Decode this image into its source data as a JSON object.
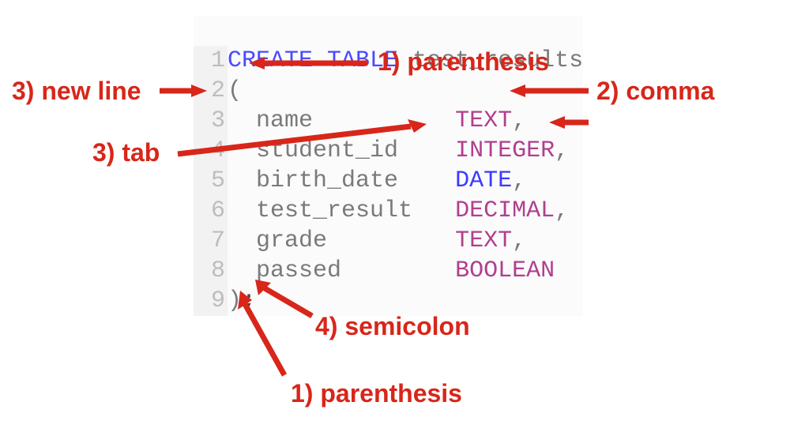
{
  "code": {
    "lines": [
      {
        "n": "1",
        "text": "CREATE TABLE test_results"
      },
      {
        "n": "2",
        "text": "("
      },
      {
        "n": "3",
        "text": "  name          TEXT,"
      },
      {
        "n": "4",
        "text": "  student_id    INTEGER,"
      },
      {
        "n": "5",
        "text": "  birth_date    DATE,"
      },
      {
        "n": "6",
        "text": "  test_result   DECIMAL,"
      },
      {
        "n": "7",
        "text": "  grade         TEXT,"
      },
      {
        "n": "8",
        "text": "  passed        BOOLEAN"
      },
      {
        "n": "9",
        "text": ");"
      }
    ],
    "tokens": {
      "create": "CREATE",
      "table": "TABLE",
      "tname": "test_results",
      "open": "(",
      "close": ")",
      "semi": ";",
      "cols": [
        {
          "name": "name",
          "type": "TEXT",
          "comma": ","
        },
        {
          "name": "student_id",
          "type": "INTEGER",
          "comma": ","
        },
        {
          "name": "birth_date",
          "type": "DATE",
          "comma": ","
        },
        {
          "name": "test_result",
          "type": "DECIMAL",
          "comma": ","
        },
        {
          "name": "grade",
          "type": "TEXT",
          "comma": ","
        },
        {
          "name": "passed",
          "type": "BOOLEAN",
          "comma": ""
        }
      ]
    }
  },
  "annotations": {
    "paren_top": "1) parenthesis",
    "comma": "2) comma",
    "newline": "3) new line",
    "tab": "3) tab",
    "semicolon": "4) semicolon",
    "paren_bottom": "1) parenthesis"
  }
}
